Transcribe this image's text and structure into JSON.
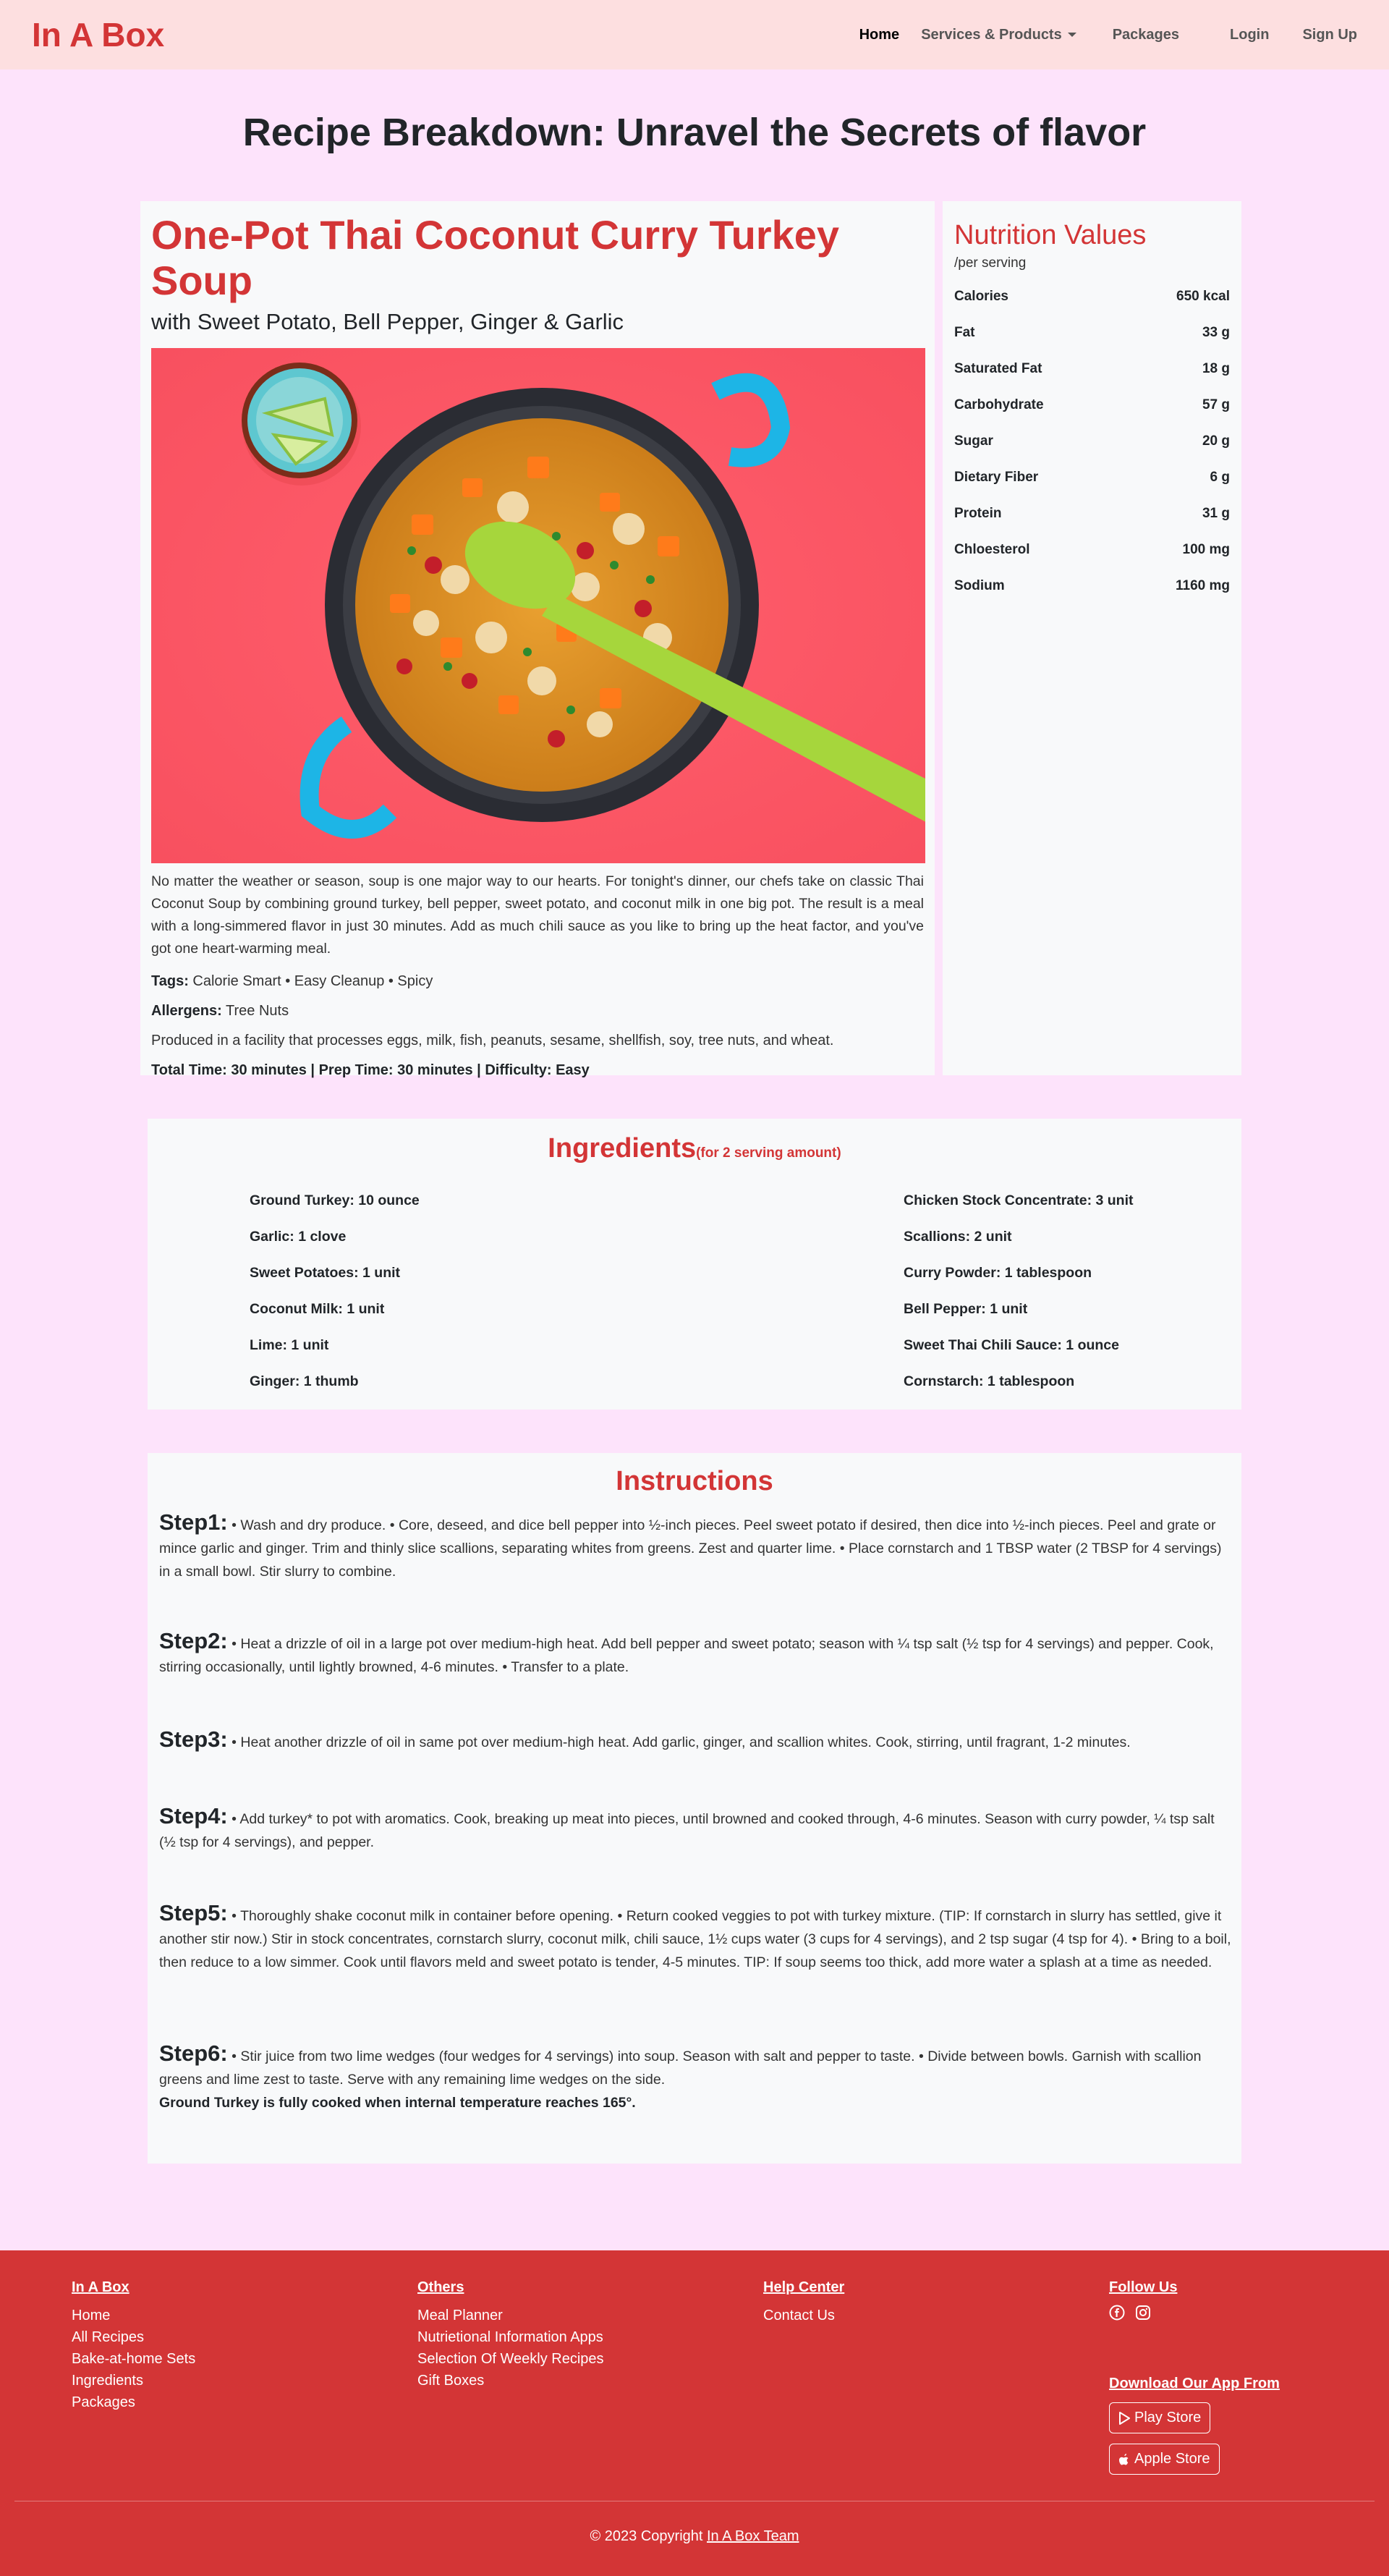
{
  "nav": {
    "brand": "In A Box",
    "links": [
      "Home",
      "Services & Products",
      "Packages",
      "Login",
      "Sign Up"
    ]
  },
  "page_title": "Recipe Breakdown: Unravel the Secrets of flavor",
  "recipe": {
    "name": "One-Pot Thai Coconut Curry Turkey Soup",
    "subtitle": "with Sweet Potato, Bell Pepper, Ginger & Garlic",
    "description": "No matter the weather or season, soup is one major way to our hearts. For tonight's dinner, our chefs take on classic Thai Coconut Soup by combining ground turkey, bell pepper, sweet potato, and coconut milk in one big pot. The result is a meal with a long-simmered flavor in just 30 minutes. Add as much chili sauce as you like to bring up the heat factor, and you've got one heart-warming meal.",
    "tags_label": "Tags:",
    "tags": "Calorie Smart • Easy Cleanup • Spicy",
    "allergens_label": "Allergens:",
    "allergens": "Tree Nuts",
    "facility_note": "Produced in a facility that processes eggs, milk, fish, peanuts, sesame, shellfish, soy, tree nuts, and wheat.",
    "time_info": "Total Time: 30 minutes | Prep Time: 30 minutes | Difficulty: Easy"
  },
  "nutrition": {
    "title": "Nutrition Values",
    "per": "/per serving",
    "rows": [
      {
        "label": "Calories",
        "value": "650 kcal"
      },
      {
        "label": "Fat",
        "value": "33 g"
      },
      {
        "label": "Saturated Fat",
        "value": "18 g"
      },
      {
        "label": "Carbohydrate",
        "value": "57 g"
      },
      {
        "label": "Sugar",
        "value": "20 g"
      },
      {
        "label": "Dietary Fiber",
        "value": "6 g"
      },
      {
        "label": "Protein",
        "value": "31 g"
      },
      {
        "label": "Chloesterol",
        "value": "100 mg"
      },
      {
        "label": "Sodium",
        "value": "1160 mg"
      }
    ]
  },
  "ingredients": {
    "title": "Ingredients",
    "subtitle": "(for 2 serving amount)",
    "left": [
      "Ground Turkey: 10 ounce",
      "Garlic: 1 clove",
      "Sweet Potatoes: 1 unit",
      "Coconut Milk: 1 unit",
      "Lime: 1 unit",
      "Ginger: 1 thumb"
    ],
    "right": [
      "Chicken Stock Concentrate: 3 unit",
      "Scallions: 2 unit",
      "Curry Powder: 1 tablespoon",
      "Bell Pepper: 1 unit",
      "Sweet Thai Chili Sauce: 1 ounce",
      "Cornstarch: 1 tablespoon"
    ]
  },
  "instructions": {
    "title": "Instructions",
    "steps": [
      {
        "label": "Step1:",
        "text": "• Wash and dry produce. • Core, deseed, and dice bell pepper into ½-inch pieces. Peel sweet potato if desired, then dice into ½-inch pieces. Peel and grate or mince garlic and ginger. Trim and thinly slice scallions, separating whites from greens. Zest and quarter lime. • Place cornstarch and 1 TBSP water (2 TBSP for 4 servings) in a small bowl. Stir slurry to combine."
      },
      {
        "label": "Step2:",
        "text": "• Heat a drizzle of oil in a large pot over medium-high heat. Add bell pepper and sweet potato; season with ¼ tsp salt (½ tsp for 4 servings) and pepper. Cook, stirring occasionally, until lightly browned, 4-6 minutes. • Transfer to a plate."
      },
      {
        "label": "Step3:",
        "text": "• Heat another drizzle of oil in same pot over medium-high heat. Add garlic, ginger, and scallion whites. Cook, stirring, until fragrant, 1-2 minutes."
      },
      {
        "label": "Step4:",
        "text": "• Add turkey* to pot with aromatics. Cook, breaking up meat into pieces, until browned and cooked through, 4-6 minutes. Season with curry powder, ¼ tsp salt (½ tsp for 4 servings), and pepper."
      },
      {
        "label": "Step5:",
        "text": "• Thoroughly shake coconut milk in container before opening. • Return cooked veggies to pot with turkey mixture. (TIP: If cornstarch in slurry has settled, give it another stir now.) Stir in stock concentrates, cornstarch slurry, coconut milk, chili sauce, 1½ cups water (3 cups for 4 servings), and 2 tsp sugar (4 tsp for 4). • Bring to a boil, then reduce to a low simmer. Cook until flavors meld and sweet potato is tender, 4-5 minutes. TIP: If soup seems too thick, add more water a splash at a time as needed."
      },
      {
        "label": "Step6:",
        "text": "• Stir juice from two lime wedges (four wedges for 4 servings) into soup. Season with salt and pepper to taste. • Divide between bowls. Garnish with scallion greens and lime zest to taste. Serve with any remaining lime wedges on the side."
      }
    ],
    "note": "Ground Turkey is fully cooked when internal temperature reaches 165°."
  },
  "footer": {
    "col1_head": "In A Box",
    "col1_links": [
      "Home",
      "All Recipes",
      "Bake-at-home Sets",
      "Ingredients",
      "Packages"
    ],
    "col2_head": "Others",
    "col2_links": [
      "Meal Planner",
      "Nutrietional Information Apps",
      "Selection Of Weekly Recipes",
      "Gift Boxes"
    ],
    "col3_head": "Help Center",
    "col3_links": [
      "Contact Us"
    ],
    "col4_head": "Follow Us",
    "download_head": "Download Our App From",
    "play_store": "Play Store",
    "apple_store": "Apple Store",
    "copyright_prefix": "© 2023 Copyright",
    "copyright_link": "In A Box Team"
  }
}
